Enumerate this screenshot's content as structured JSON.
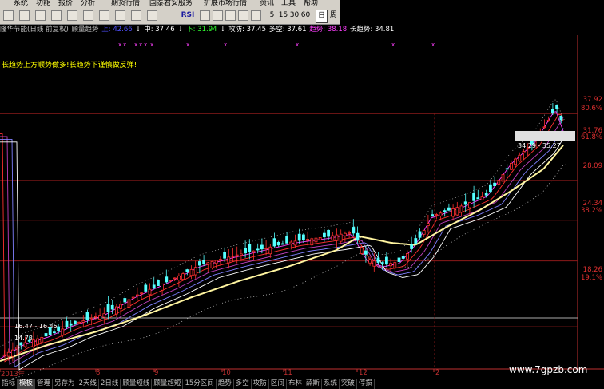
{
  "menu": [
    "系统",
    "功能",
    "报价",
    "分析",
    "期货行情",
    "国泰君安服务",
    "扩展市场行情",
    "资讯",
    "工具",
    "帮助"
  ],
  "toolbar": {
    "rsi_label": "RSI",
    "periods": [
      "5",
      "15",
      "30",
      "60"
    ],
    "day_label": "日",
    "week_label": "周"
  },
  "info": {
    "name": "隆华节能(日线 前复权)",
    "indicator": "顾量趋势",
    "upper_label": "上: 42.66",
    "mid_label": "中: 37.46",
    "lower_label": "下: 31.94",
    "attack_label": "攻防: 37.45",
    "longshort_label": "多空: 37.61",
    "trend_label": "趋势: 38.18",
    "longtrend_label": "长趋势: 34.81"
  },
  "note": "长趋势上方顺势做多!长趋势下谨慎做反弹!",
  "price_labels": [
    {
      "text": "37.92",
      "color": "#e03030"
    },
    {
      "text": "80.6%",
      "color": "#e03030"
    },
    {
      "text": "31.76",
      "color": "#e03030"
    },
    {
      "text": "61.8%",
      "color": "#e03030"
    },
    {
      "text": "28.09",
      "color": "#e03030"
    },
    {
      "text": "24.34",
      "color": "#e03030"
    },
    {
      "text": "38.2%",
      "color": "#e03030"
    },
    {
      "text": "18.26",
      "color": "#e03030"
    },
    {
      "text": "19.1%",
      "color": "#e03030"
    }
  ],
  "annotations": {
    "range_box": "34.29 - 35.27",
    "low_note": "16.47 - 16.45",
    "low_price": "14.73"
  },
  "x_labels": [
    "2013年",
    "8",
    "9",
    "10",
    "11",
    "12",
    "2"
  ],
  "bottom_tabs": [
    "指标",
    "模板",
    "管理",
    "另存为",
    "2天线",
    "2日线",
    "顾量短线",
    "顾量超短",
    "15分区间",
    "趋势",
    "多空",
    "攻防",
    "区间",
    "布林",
    "薛斯",
    "系统",
    "突破",
    "停损"
  ],
  "bottom_active": 1,
  "watermark": "www.7gpzb.com",
  "colors": {
    "up": "#ff3030",
    "down": "#54ffff",
    "long_trend": "#fff5a0",
    "mid_line": "#ffffff",
    "dotted_band": "#c0c0c0",
    "fib_line": "#8b1a1a",
    "menu_bg": "#d4d0c8"
  }
}
